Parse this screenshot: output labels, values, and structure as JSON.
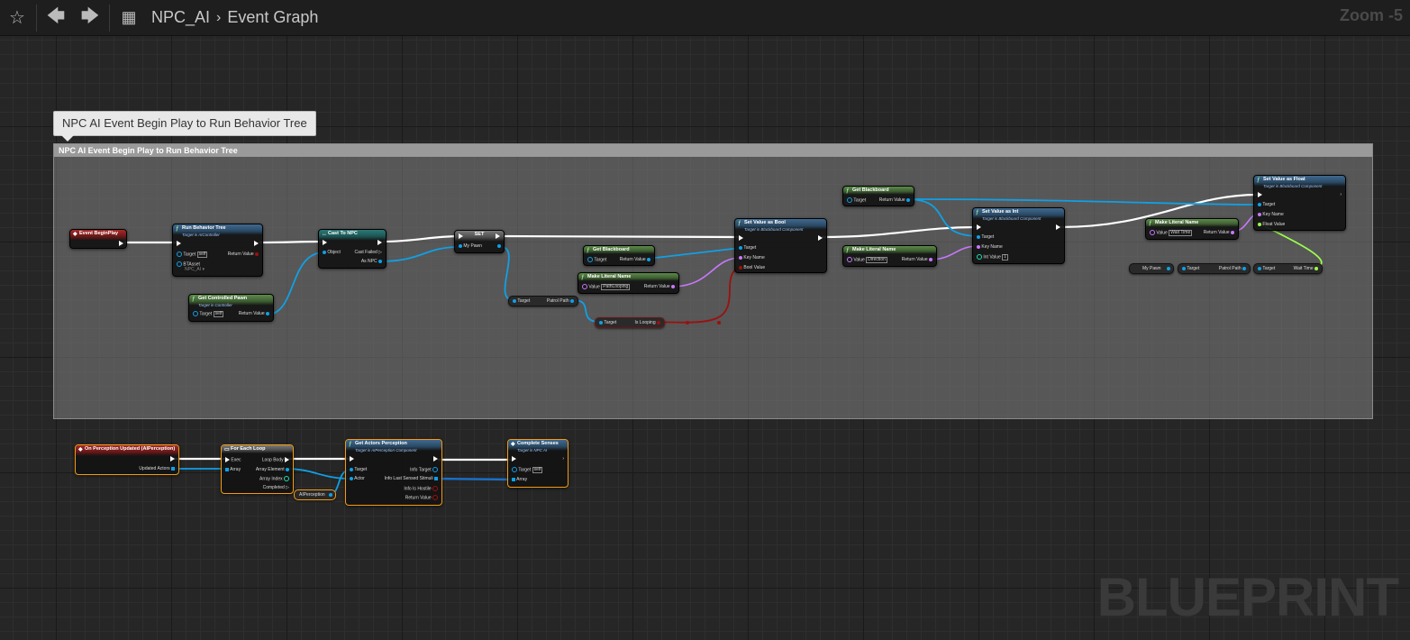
{
  "toolbar": {
    "breadcrumb_root": "NPC_AI",
    "breadcrumb_page": "Event Graph",
    "zoom": "Zoom -5"
  },
  "watermark": "BLUEPRINT",
  "comment": {
    "bubble": "NPC AI Event Begin Play to Run Behavior Tree",
    "title": "NPC AI Event Begin Play to Run Behavior Tree"
  },
  "nodes": {
    "begin_play": {
      "title": "Event BeginPlay"
    },
    "run_bt": {
      "title": "Run Behavior Tree",
      "subtitle": "Target is AIController",
      "target": "Target",
      "target_val": "self",
      "bt_asset": "BTAsset",
      "bt_asset_val": "NPC_AI",
      "return": "Return Value"
    },
    "get_pawn": {
      "title": "Get Controlled Pawn",
      "subtitle": "Target is Controller",
      "target": "Target",
      "target_val": "self",
      "return": "Return Value"
    },
    "cast_npc": {
      "title": "Cast To NPC",
      "object": "Object",
      "cast_failed": "Cast Failed",
      "as_npc": "As NPC"
    },
    "set_pawn": {
      "title": "SET",
      "var": "My Pawn"
    },
    "get_patrol": {
      "target": "Target",
      "label": "Patrol Path"
    },
    "get_looping": {
      "target": "Target",
      "label": "Is Looping"
    },
    "get_bb1": {
      "title": "Get Blackboard",
      "target": "Target",
      "return": "Return Value"
    },
    "make_name1": {
      "title": "Make Literal Name",
      "value": "Value",
      "value_val": "PathLooping",
      "return": "Return Value"
    },
    "set_bool": {
      "title": "Set Value as Bool",
      "subtitle": "Target is Blackboard Component",
      "target": "Target",
      "key": "Key Name",
      "bool": "Bool Value"
    },
    "get_bb2": {
      "title": "Get Blackboard",
      "target": "Target",
      "return": "Return Value"
    },
    "make_name2": {
      "title": "Make Literal Name",
      "value": "Value",
      "value_val": "Direction",
      "return": "Return Value"
    },
    "set_int": {
      "title": "Set Value as Int",
      "subtitle": "Target is Blackboard Component",
      "target": "Target",
      "key": "Key Name",
      "int": "Int Value",
      "int_val": "1"
    },
    "make_name3": {
      "title": "Make Literal Name",
      "value": "Value",
      "value_val": "Wait Time",
      "return": "Return Value"
    },
    "set_float": {
      "title": "Set Value as Float",
      "subtitle": "Target is Blackboard Component",
      "target": "Target",
      "key": "Key Name",
      "float": "Float Value"
    },
    "var_mypawn": {
      "label": "My Pawn"
    },
    "var_patrol2": {
      "target": "Target",
      "label": "Patrol Path"
    },
    "var_wait": {
      "target": "Target",
      "label": "Wait Time"
    },
    "on_perception": {
      "title": "On Perception Updated (AIPerception)",
      "actors": "Updated Actors"
    },
    "for_each": {
      "title": "For Each Loop",
      "exec": "Exec",
      "array": "Array",
      "loop_body": "Loop Body",
      "element": "Array Element",
      "index": "Array Index",
      "completed": "Completed"
    },
    "aiperception_var": {
      "label": "AIPerception"
    },
    "get_perception": {
      "title": "Get Actors Perception",
      "subtitle": "Target is AIPerception Component",
      "target": "Target",
      "actor": "Actor",
      "info_target": "Info Target",
      "info_last": "Info Last Sensed Stimuli",
      "info_hostile": "Info Is Hostile",
      "return": "Return Value"
    },
    "complete_senses": {
      "title": "Complete Senses",
      "subtitle": "Target is NPC AI",
      "target": "Target",
      "target_val": "self",
      "array": "Array"
    }
  }
}
